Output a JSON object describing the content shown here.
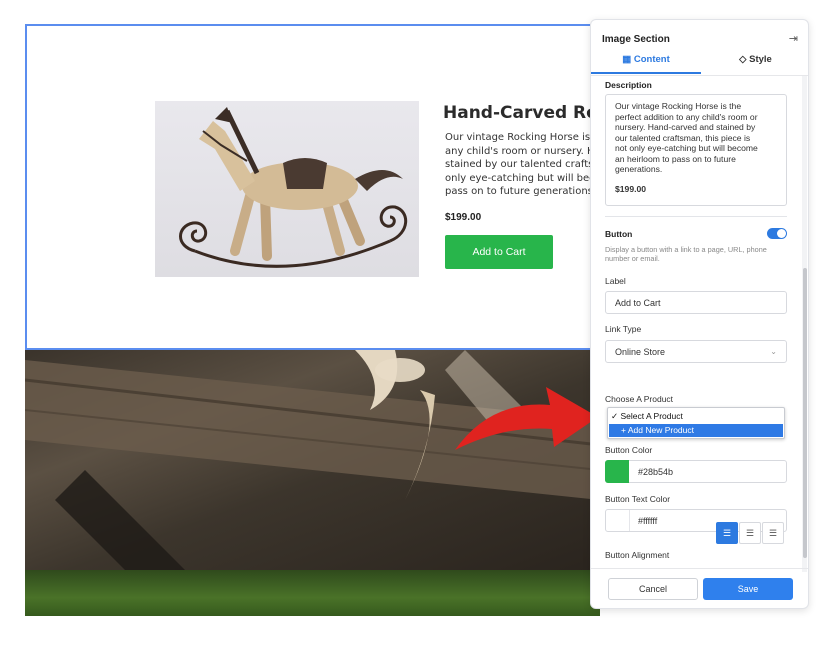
{
  "product": {
    "title": "Hand-Carved Rock",
    "description": "Our vintage Rocking Horse is the\nany child's room or nursery. Han\nstained by our talented craftsma\nonly eye-catching but will becom\npass on to future generations.",
    "price": "$199.00",
    "button_label": "Add to Cart",
    "button_color": "#28b54b"
  },
  "panel": {
    "title": "Image Section",
    "tabs": [
      {
        "label": "Content",
        "icon": "content-grid-icon",
        "active": true
      },
      {
        "label": "Style",
        "icon": "paint-bucket-icon",
        "active": false
      }
    ],
    "description": {
      "label": "Description",
      "text": "Our vintage Rocking Horse is the\nperfect addition to any child's room or\nnursery. Hand-carved and stained by\nour talented craftsman, this piece is\nnot only eye-catching but will become\nan heirloom to pass on to future\ngenerations.",
      "price": "$199.00"
    },
    "button_section": {
      "label": "Button",
      "enabled": true,
      "help": "Display a button with a link to a page, URL, phone number or email."
    },
    "label_field": {
      "label": "Label",
      "value": "Add to Cart"
    },
    "link_type": {
      "label": "Link Type",
      "value": "Online Store"
    },
    "choose_product": {
      "label": "Choose A Product",
      "options": [
        "✓ Select A Product",
        "+ Add New Product"
      ],
      "highlighted": "+ Add New Product"
    },
    "button_color": {
      "label": "Button Color",
      "value": "#28b54b"
    },
    "button_text_color": {
      "label": "Button Text Color",
      "value": "#ffffff"
    },
    "button_alignment": {
      "label": "Button Alignment",
      "selected": "left"
    },
    "cancel_label": "Cancel",
    "save_label": "Save"
  },
  "colors": {
    "accent": "#2d7ae0",
    "selection_border": "#5b8def",
    "arrow": "#e0231f"
  }
}
